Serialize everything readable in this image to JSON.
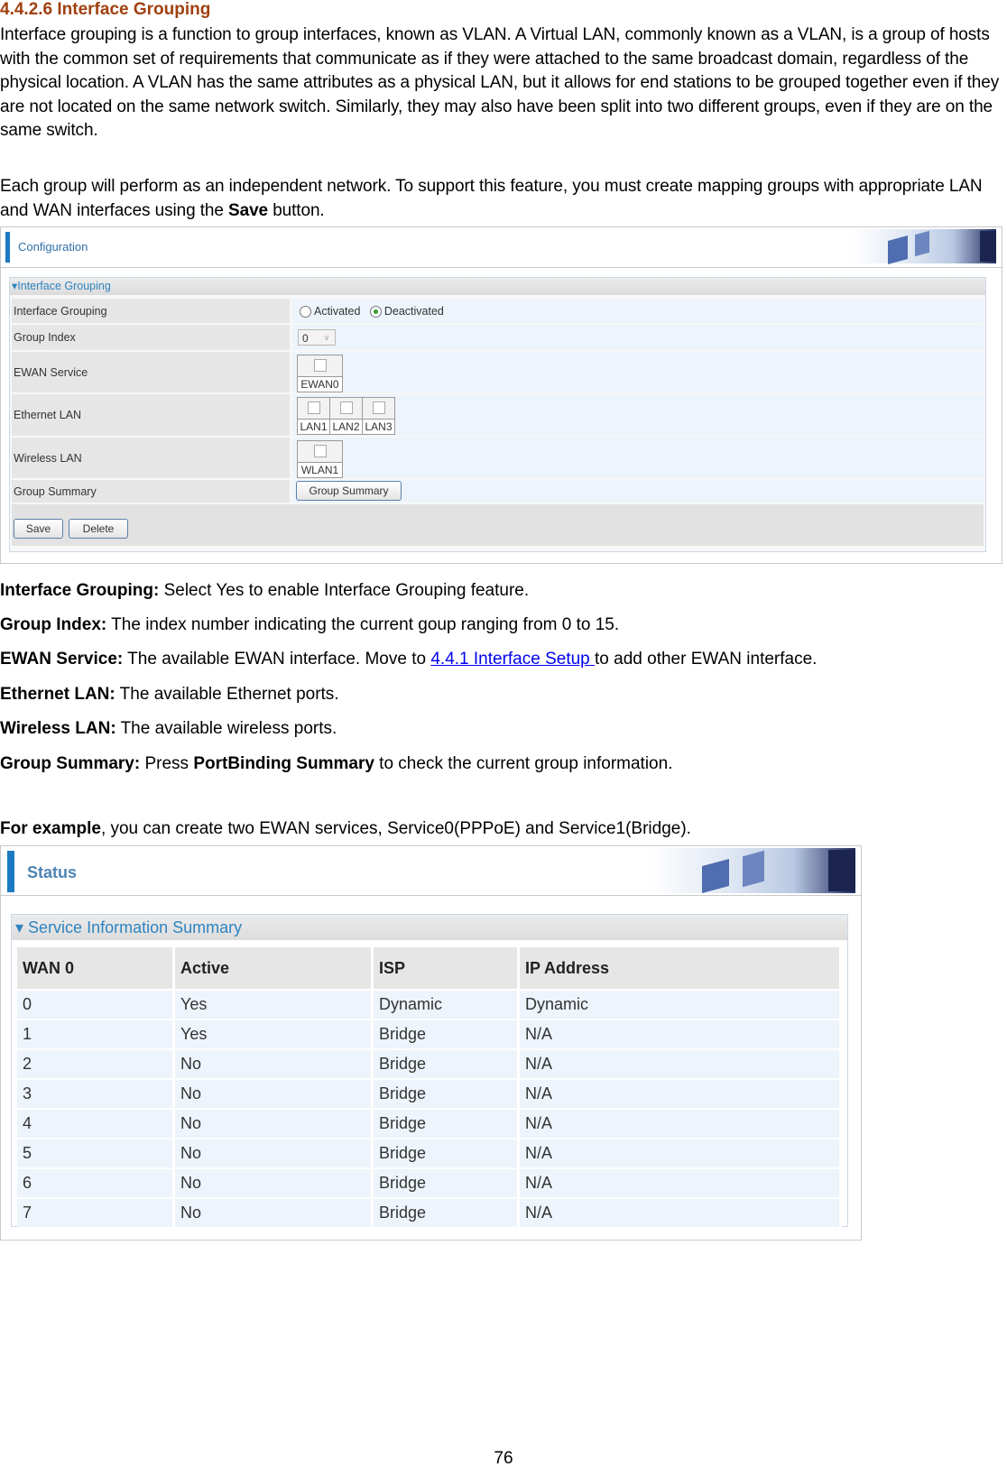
{
  "heading": "4.4.2.6 Interface Grouping",
  "intro_paragraph": "Interface grouping is a function to group interfaces, known as VLAN. A Virtual LAN, commonly known as a VLAN, is a group of hosts with the common set of requirements that communicate as if they were attached to the same broadcast domain, regardless of the physical location. A VLAN has the same attributes as a physical LAN, but it allows for end stations to be grouped together even if they are not located on the same network switch. Similarly, they may also have been split into two different groups, even if they are on the same switch.",
  "second_paragraph": {
    "before": "Each group will perform as an independent network. To support this feature, you must create mapping groups with appropriate LAN and WAN interfaces using the ",
    "bold": "Save",
    "after": " button."
  },
  "config_screenshot": {
    "bar_title": "Configuration",
    "panel_title": "Interface Grouping",
    "rows": {
      "interface_grouping": {
        "label": "Interface Grouping",
        "option_activated": "Activated",
        "option_deactivated": "Deactivated",
        "selected": "Deactivated"
      },
      "group_index": {
        "label": "Group Index",
        "value": "0"
      },
      "ewan_service": {
        "label": "EWAN Service",
        "ports": [
          "EWAN0"
        ]
      },
      "ethernet_lan": {
        "label": "Ethernet LAN",
        "ports": [
          "LAN1",
          "LAN2",
          "LAN3"
        ]
      },
      "wireless_lan": {
        "label": "Wireless LAN",
        "ports": [
          "WLAN1"
        ]
      },
      "group_summary": {
        "label": "Group Summary",
        "button": "Group Summary"
      }
    },
    "save_button": "Save",
    "delete_button": "Delete"
  },
  "descriptions": [
    {
      "term": "Interface Grouping:",
      "text": " Select Yes to enable Interface Grouping feature."
    },
    {
      "term": "Group Index:",
      "text": " The index number indicating the current goup ranging from 0 to 15."
    },
    {
      "term": "EWAN Service:",
      "text": " The available EWAN interface. Move to ",
      "link": "4.4.1 Interface Setup ",
      "after": "to add other EWAN interface."
    },
    {
      "term": "Ethernet LAN:",
      "text": " The available Ethernet ports."
    },
    {
      "term": "Wireless LAN:",
      "text": " The available wireless ports."
    },
    {
      "term": "Group Summary:",
      "text": " Press ",
      "bold2": "PortBinding Summary",
      "after": " to check the current group information."
    }
  ],
  "example": {
    "bold": "For example",
    "text": ", you can create two EWAN services, Service0(PPPoE) and Service1(Bridge)."
  },
  "status_screenshot": {
    "bar_title": "Status",
    "panel_title": "Service Information Summary",
    "columns": [
      "WAN 0",
      "Active",
      "ISP",
      "IP Address"
    ],
    "rows": [
      [
        "0",
        "Yes",
        "Dynamic",
        "Dynamic"
      ],
      [
        "1",
        "Yes",
        "Bridge",
        "N/A"
      ],
      [
        "2",
        "No",
        "Bridge",
        "N/A"
      ],
      [
        "3",
        "No",
        "Bridge",
        "N/A"
      ],
      [
        "4",
        "No",
        "Bridge",
        "N/A"
      ],
      [
        "5",
        "No",
        "Bridge",
        "N/A"
      ],
      [
        "6",
        "No",
        "Bridge",
        "N/A"
      ],
      [
        "7",
        "No",
        "Bridge",
        "N/A"
      ]
    ]
  },
  "page_number": "76"
}
